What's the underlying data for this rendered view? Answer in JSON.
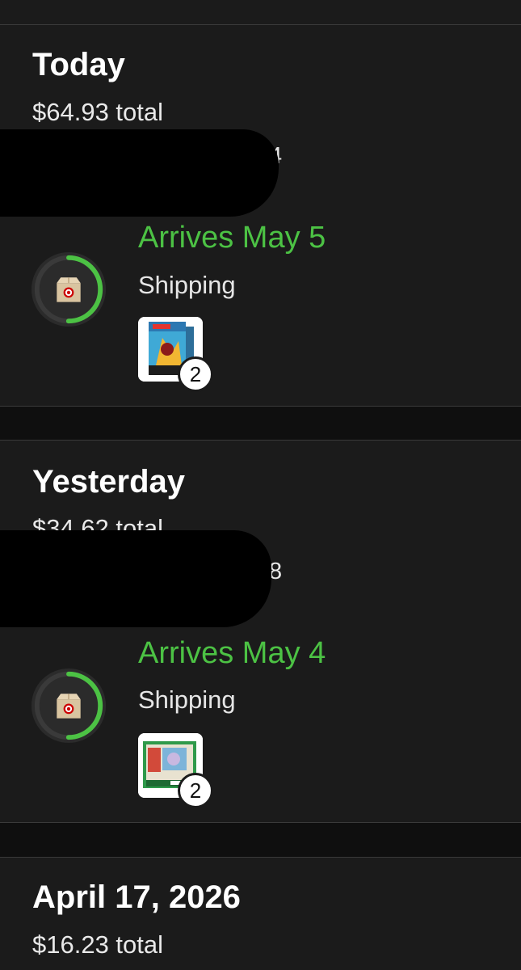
{
  "orders": [
    {
      "date_label": "Today",
      "total": "$64.93 total",
      "order_number_visible": "4",
      "arrival": "Arrives May 5",
      "status": "Shipping",
      "item_count": "2",
      "progress_fraction": 0.5
    },
    {
      "date_label": "Yesterday",
      "total": "$34.62 total",
      "order_number_visible": "8",
      "arrival": "Arrives May 4",
      "status": "Shipping",
      "item_count": "2",
      "progress_fraction": 0.5
    },
    {
      "date_label": "April 17, 2026",
      "total": "$16.23 total"
    }
  ],
  "icons": {
    "progress": "package-box-icon",
    "brand": "target-logo-icon"
  },
  "colors": {
    "background": "#0f0f0f",
    "card": "#1b1b1b",
    "accent_green": "#4cc244",
    "ring_track": "#3a3a3a"
  }
}
